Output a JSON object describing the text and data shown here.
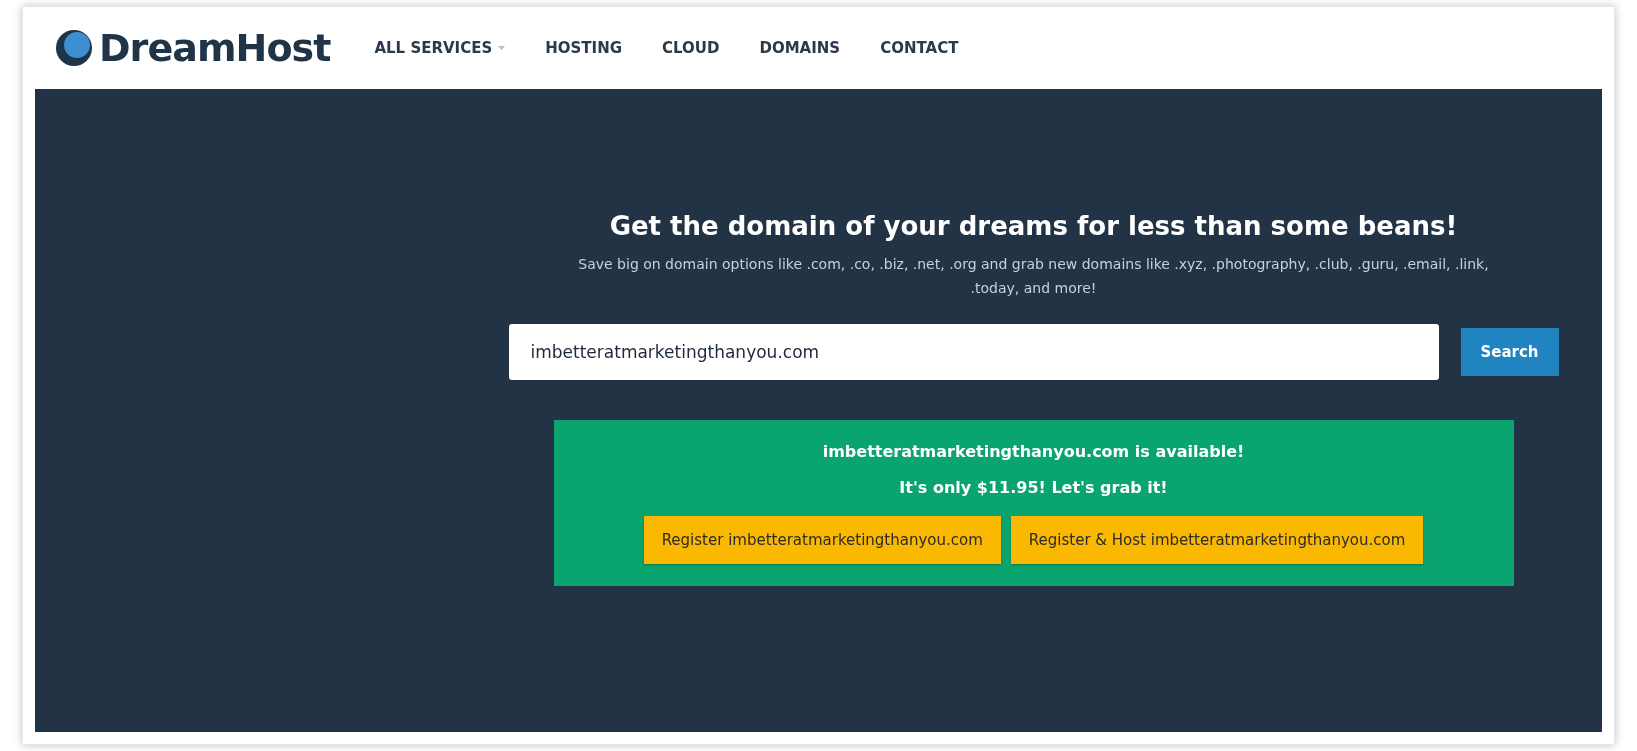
{
  "header": {
    "logo": "DreamHost",
    "nav": [
      {
        "label": "ALL SERVICES",
        "has_dropdown": true
      },
      {
        "label": "HOSTING",
        "has_dropdown": false
      },
      {
        "label": "CLOUD",
        "has_dropdown": false
      },
      {
        "label": "DOMAINS",
        "has_dropdown": false
      },
      {
        "label": "CONTACT",
        "has_dropdown": false
      }
    ]
  },
  "hero": {
    "title": "Get the domain of your dreams for less than some beans!",
    "subtitle": "Save big on domain options like .com, .co, .biz, .net, .org and grab new domains like .xyz, .photography, .club, .guru, .email, .link, .today, and more!",
    "search": {
      "value": "imbetteratmarketingthanyou.com",
      "button": "Search"
    },
    "result": {
      "message": "imbetteratmarketingthanyou.com is available!",
      "price": "It's only $11.95! Let's grab it!",
      "buttons": [
        "Register imbetteratmarketingthanyou.com",
        "Register & Host imbetteratmarketingthanyou.com"
      ]
    }
  }
}
